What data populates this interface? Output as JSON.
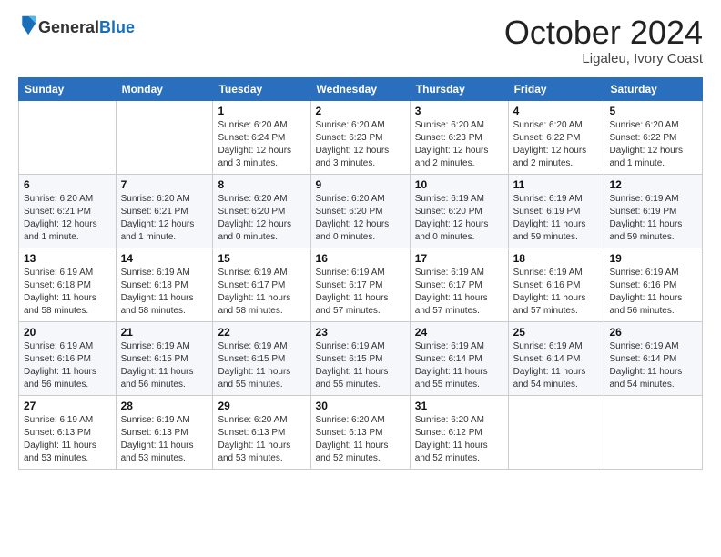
{
  "header": {
    "logo_general": "General",
    "logo_blue": "Blue",
    "month_title": "October 2024",
    "subtitle": "Ligaleu, Ivory Coast"
  },
  "days_of_week": [
    "Sunday",
    "Monday",
    "Tuesday",
    "Wednesday",
    "Thursday",
    "Friday",
    "Saturday"
  ],
  "weeks": [
    [
      {
        "day": "",
        "info": ""
      },
      {
        "day": "",
        "info": ""
      },
      {
        "day": "1",
        "info": "Sunrise: 6:20 AM\nSunset: 6:24 PM\nDaylight: 12 hours and 3 minutes."
      },
      {
        "day": "2",
        "info": "Sunrise: 6:20 AM\nSunset: 6:23 PM\nDaylight: 12 hours and 3 minutes."
      },
      {
        "day": "3",
        "info": "Sunrise: 6:20 AM\nSunset: 6:23 PM\nDaylight: 12 hours and 2 minutes."
      },
      {
        "day": "4",
        "info": "Sunrise: 6:20 AM\nSunset: 6:22 PM\nDaylight: 12 hours and 2 minutes."
      },
      {
        "day": "5",
        "info": "Sunrise: 6:20 AM\nSunset: 6:22 PM\nDaylight: 12 hours and 1 minute."
      }
    ],
    [
      {
        "day": "6",
        "info": "Sunrise: 6:20 AM\nSunset: 6:21 PM\nDaylight: 12 hours and 1 minute."
      },
      {
        "day": "7",
        "info": "Sunrise: 6:20 AM\nSunset: 6:21 PM\nDaylight: 12 hours and 1 minute."
      },
      {
        "day": "8",
        "info": "Sunrise: 6:20 AM\nSunset: 6:20 PM\nDaylight: 12 hours and 0 minutes."
      },
      {
        "day": "9",
        "info": "Sunrise: 6:20 AM\nSunset: 6:20 PM\nDaylight: 12 hours and 0 minutes."
      },
      {
        "day": "10",
        "info": "Sunrise: 6:19 AM\nSunset: 6:20 PM\nDaylight: 12 hours and 0 minutes."
      },
      {
        "day": "11",
        "info": "Sunrise: 6:19 AM\nSunset: 6:19 PM\nDaylight: 11 hours and 59 minutes."
      },
      {
        "day": "12",
        "info": "Sunrise: 6:19 AM\nSunset: 6:19 PM\nDaylight: 11 hours and 59 minutes."
      }
    ],
    [
      {
        "day": "13",
        "info": "Sunrise: 6:19 AM\nSunset: 6:18 PM\nDaylight: 11 hours and 58 minutes."
      },
      {
        "day": "14",
        "info": "Sunrise: 6:19 AM\nSunset: 6:18 PM\nDaylight: 11 hours and 58 minutes."
      },
      {
        "day": "15",
        "info": "Sunrise: 6:19 AM\nSunset: 6:17 PM\nDaylight: 11 hours and 58 minutes."
      },
      {
        "day": "16",
        "info": "Sunrise: 6:19 AM\nSunset: 6:17 PM\nDaylight: 11 hours and 57 minutes."
      },
      {
        "day": "17",
        "info": "Sunrise: 6:19 AM\nSunset: 6:17 PM\nDaylight: 11 hours and 57 minutes."
      },
      {
        "day": "18",
        "info": "Sunrise: 6:19 AM\nSunset: 6:16 PM\nDaylight: 11 hours and 57 minutes."
      },
      {
        "day": "19",
        "info": "Sunrise: 6:19 AM\nSunset: 6:16 PM\nDaylight: 11 hours and 56 minutes."
      }
    ],
    [
      {
        "day": "20",
        "info": "Sunrise: 6:19 AM\nSunset: 6:16 PM\nDaylight: 11 hours and 56 minutes."
      },
      {
        "day": "21",
        "info": "Sunrise: 6:19 AM\nSunset: 6:15 PM\nDaylight: 11 hours and 56 minutes."
      },
      {
        "day": "22",
        "info": "Sunrise: 6:19 AM\nSunset: 6:15 PM\nDaylight: 11 hours and 55 minutes."
      },
      {
        "day": "23",
        "info": "Sunrise: 6:19 AM\nSunset: 6:15 PM\nDaylight: 11 hours and 55 minutes."
      },
      {
        "day": "24",
        "info": "Sunrise: 6:19 AM\nSunset: 6:14 PM\nDaylight: 11 hours and 55 minutes."
      },
      {
        "day": "25",
        "info": "Sunrise: 6:19 AM\nSunset: 6:14 PM\nDaylight: 11 hours and 54 minutes."
      },
      {
        "day": "26",
        "info": "Sunrise: 6:19 AM\nSunset: 6:14 PM\nDaylight: 11 hours and 54 minutes."
      }
    ],
    [
      {
        "day": "27",
        "info": "Sunrise: 6:19 AM\nSunset: 6:13 PM\nDaylight: 11 hours and 53 minutes."
      },
      {
        "day": "28",
        "info": "Sunrise: 6:19 AM\nSunset: 6:13 PM\nDaylight: 11 hours and 53 minutes."
      },
      {
        "day": "29",
        "info": "Sunrise: 6:20 AM\nSunset: 6:13 PM\nDaylight: 11 hours and 53 minutes."
      },
      {
        "day": "30",
        "info": "Sunrise: 6:20 AM\nSunset: 6:13 PM\nDaylight: 11 hours and 52 minutes."
      },
      {
        "day": "31",
        "info": "Sunrise: 6:20 AM\nSunset: 6:12 PM\nDaylight: 11 hours and 52 minutes."
      },
      {
        "day": "",
        "info": ""
      },
      {
        "day": "",
        "info": ""
      }
    ]
  ]
}
